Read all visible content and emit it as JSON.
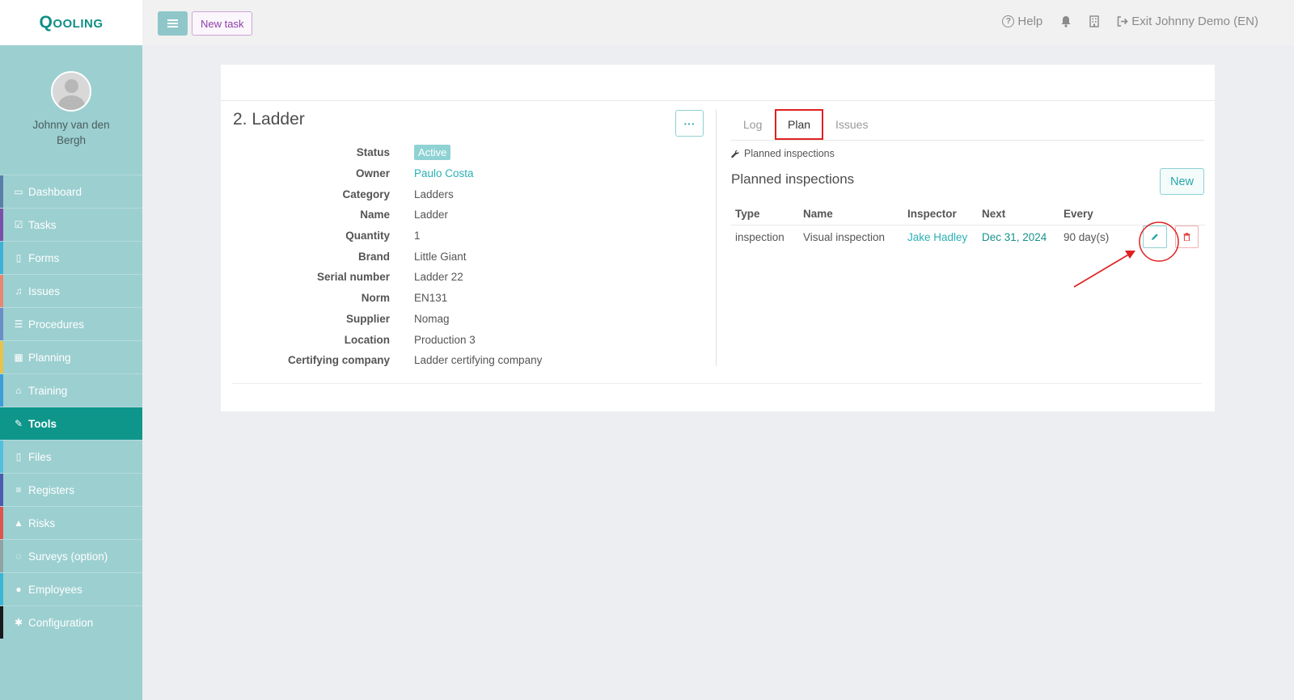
{
  "app": {
    "logo": "Qooling"
  },
  "topbar": {
    "new_task": "New task",
    "help": "Help",
    "exit": "Exit Johnny Demo (EN)"
  },
  "sidebar": {
    "user_name": "Johnny van den Bergh",
    "items": [
      {
        "label": "Dashboard",
        "icon": "monitor-icon",
        "color": "#5a7ea8"
      },
      {
        "label": "Tasks",
        "icon": "check-square-icon",
        "color": "#7b4fa8"
      },
      {
        "label": "Forms",
        "icon": "file-icon",
        "color": "#3eb1d8"
      },
      {
        "label": "Issues",
        "icon": "bell-icon",
        "color": "#e8866f"
      },
      {
        "label": "Procedures",
        "icon": "list-icon",
        "color": "#6b8ec9"
      },
      {
        "label": "Planning",
        "icon": "calendar-icon",
        "color": "#e6c34a"
      },
      {
        "label": "Training",
        "icon": "graduation-cap-icon",
        "color": "#3c9ed8"
      },
      {
        "label": "Tools",
        "icon": "wrench-icon",
        "color": "#0e968b"
      },
      {
        "label": "Files",
        "icon": "file-pdf-icon",
        "color": "#53bfe0"
      },
      {
        "label": "Registers",
        "icon": "list-lines-icon",
        "color": "#4b5bb0"
      },
      {
        "label": "Risks",
        "icon": "warning-icon",
        "color": "#e0544b"
      },
      {
        "label": "Surveys (option)",
        "icon": "chat-icon",
        "color": "#8fa3a5"
      },
      {
        "label": "Employees",
        "icon": "users-icon",
        "color": "#3ab5d6"
      },
      {
        "label": "Configuration",
        "icon": "gear-icon",
        "color": "#1a1a1a"
      }
    ],
    "active": "Tools"
  },
  "tool": {
    "title": "2. Ladder",
    "properties": [
      {
        "label": "Status",
        "value": "Active",
        "kind": "badge"
      },
      {
        "label": "Owner",
        "value": "Paulo Costa",
        "kind": "link"
      },
      {
        "label": "Category",
        "value": "Ladders",
        "kind": "text"
      },
      {
        "label": "Name",
        "value": "Ladder",
        "kind": "text"
      },
      {
        "label": "Quantity",
        "value": "1",
        "kind": "text"
      },
      {
        "label": "Brand",
        "value": "Little Giant",
        "kind": "text"
      },
      {
        "label": "Serial number",
        "value": "Ladder 22",
        "kind": "text"
      },
      {
        "label": "Norm",
        "value": "EN131",
        "kind": "text"
      },
      {
        "label": "Supplier",
        "value": "Nomag",
        "kind": "text"
      },
      {
        "label": "Location",
        "value": "Production 3",
        "kind": "text"
      },
      {
        "label": "Certifying company",
        "value": "Ladder certifying company",
        "kind": "text"
      }
    ]
  },
  "tabs": [
    {
      "label": "Log"
    },
    {
      "label": "Plan"
    },
    {
      "label": "Issues"
    }
  ],
  "plan": {
    "crumb": "Planned inspections",
    "title": "Planned inspections",
    "new_button": "New",
    "columns": [
      "Type",
      "Name",
      "Inspector",
      "Next",
      "Every"
    ],
    "rows": [
      {
        "type": "inspection",
        "name": "Visual inspection",
        "inspector": "Jake Hadley",
        "next": "Dec 31, 2024",
        "every": "90 day(s)"
      }
    ]
  },
  "colors": {
    "accent": "#0e968b",
    "sidebar_bg": "#9ccfd0",
    "highlight": "#e02020"
  }
}
